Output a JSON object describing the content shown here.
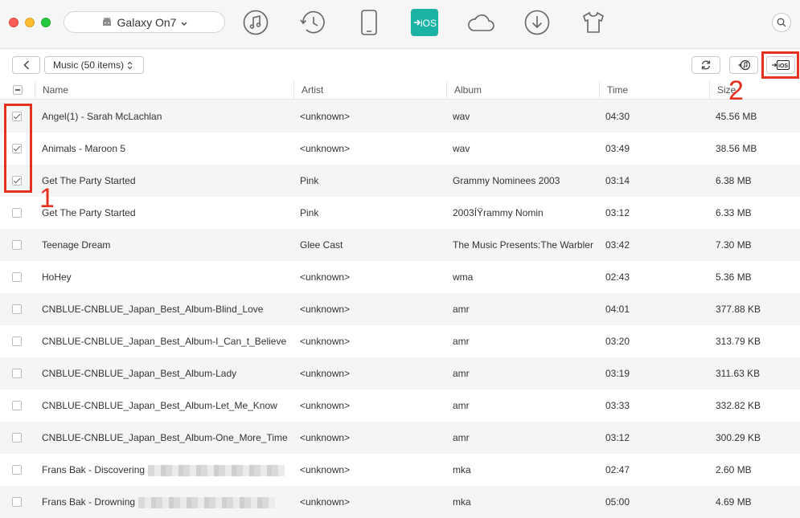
{
  "device": {
    "name": "Galaxy On7"
  },
  "nav_icons": [
    "music-note-icon",
    "history-clock-icon",
    "phone-icon",
    "to-ios-icon",
    "cloud-icon",
    "download-icon",
    "tshirt-icon"
  ],
  "nav_active": "to-ios-icon",
  "to_ios_label": "iOS",
  "category": {
    "label": "Music (50 items)"
  },
  "columns": {
    "name": "Name",
    "artist": "Artist",
    "album": "Album",
    "time": "Time",
    "size": "Size"
  },
  "to_ios_button_label": "iOS",
  "rows": [
    {
      "checked": true,
      "name": "Angel(1) - Sarah McLachlan",
      "artist": "<unknown>",
      "album": "wav",
      "time": "04:30",
      "size": "45.56 MB"
    },
    {
      "checked": true,
      "name": "Animals - Maroon 5",
      "artist": "<unknown>",
      "album": "wav",
      "time": "03:49",
      "size": "38.56 MB"
    },
    {
      "checked": true,
      "name": "Get The Party Started",
      "artist": "Pink",
      "album": "Grammy Nominees 2003",
      "time": "03:14",
      "size": "6.38 MB"
    },
    {
      "checked": false,
      "name": "Get The Party Started",
      "artist": "Pink",
      "album": "2003ÍŸrammy Nomin",
      "time": "03:12",
      "size": "6.33 MB"
    },
    {
      "checked": false,
      "name": "Teenage Dream",
      "artist": "Glee Cast",
      "album": "The Music Presents:The Warbler",
      "time": "03:42",
      "size": "7.30 MB"
    },
    {
      "checked": false,
      "name": "HoHey",
      "artist": "<unknown>",
      "album": "wma",
      "time": "02:43",
      "size": "5.36 MB"
    },
    {
      "checked": false,
      "name": "CNBLUE-CNBLUE_Japan_Best_Album-Blind_Love",
      "artist": "<unknown>",
      "album": "amr",
      "time": "04:01",
      "size": "377.88 KB"
    },
    {
      "checked": false,
      "name": "CNBLUE-CNBLUE_Japan_Best_Album-I_Can_t_Believe",
      "artist": "<unknown>",
      "album": "amr",
      "time": "03:20",
      "size": "313.79 KB"
    },
    {
      "checked": false,
      "name": "CNBLUE-CNBLUE_Japan_Best_Album-Lady",
      "artist": "<unknown>",
      "album": "amr",
      "time": "03:19",
      "size": "311.63 KB"
    },
    {
      "checked": false,
      "name": "CNBLUE-CNBLUE_Japan_Best_Album-Let_Me_Know",
      "artist": "<unknown>",
      "album": "amr",
      "time": "03:33",
      "size": "332.82 KB"
    },
    {
      "checked": false,
      "name": "CNBLUE-CNBLUE_Japan_Best_Album-One_More_Time",
      "artist": "<unknown>",
      "album": "amr",
      "time": "03:12",
      "size": "300.29 KB"
    },
    {
      "checked": false,
      "name": "Frans Bak - Discovering",
      "redacted": true,
      "artist": "<unknown>",
      "album": "mka",
      "time": "02:47",
      "size": "2.60 MB"
    },
    {
      "checked": false,
      "name": "Frans Bak - Drowning",
      "redacted": true,
      "artist": "<unknown>",
      "album": "mka",
      "time": "05:00",
      "size": "4.69 MB"
    }
  ],
  "annotations": {
    "label_1": "1",
    "label_2": "2"
  },
  "colors": {
    "accent": "#1bb3a5",
    "highlight": "#e53120"
  }
}
